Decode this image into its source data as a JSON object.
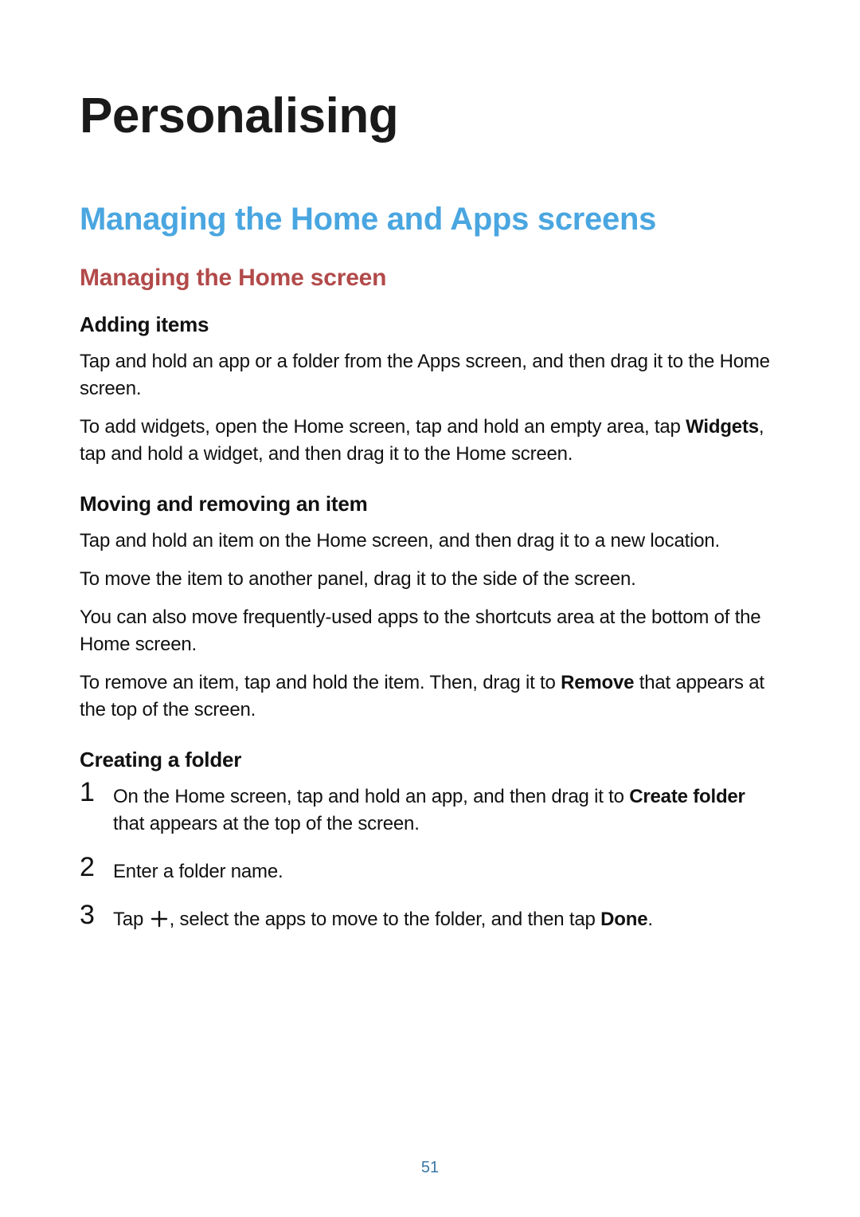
{
  "page_number": "51",
  "h1": "Personalising",
  "h2": "Managing the Home and Apps screens",
  "h3": "Managing the Home screen",
  "adding": {
    "title": "Adding items",
    "p1": "Tap and hold an app or a folder from the Apps screen, and then drag it to the Home screen.",
    "p2a": "To add widgets, open the Home screen, tap and hold an empty area, tap ",
    "p2_bold": "Widgets",
    "p2b": ", tap and hold a widget, and then drag it to the Home screen."
  },
  "moving": {
    "title": "Moving and removing an item",
    "p1": "Tap and hold an item on the Home screen, and then drag it to a new location.",
    "p2": "To move the item to another panel, drag it to the side of the screen.",
    "p3": "You can also move frequently-used apps to the shortcuts area at the bottom of the Home screen.",
    "p4a": "To remove an item, tap and hold the item. Then, drag it to ",
    "p4_bold": "Remove",
    "p4b": " that appears at the top of the screen."
  },
  "folder": {
    "title": "Creating a folder",
    "steps": {
      "s1_num": "1",
      "s1a": "On the Home screen, tap and hold an app, and then drag it to ",
      "s1_bold": "Create folder",
      "s1b": " that appears at the top of the screen.",
      "s2_num": "2",
      "s2": "Enter a folder name.",
      "s3_num": "3",
      "s3a": "Tap ",
      "s3b": ", select the apps to move to the folder, and then tap ",
      "s3_bold": "Done",
      "s3c": "."
    }
  }
}
